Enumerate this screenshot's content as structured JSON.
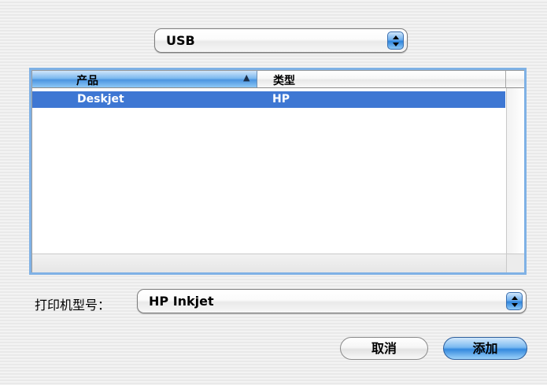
{
  "connection_popup": {
    "value": "USB"
  },
  "list": {
    "columns": [
      "产品",
      "类型"
    ],
    "sort_indicator": "▲",
    "rows": [
      {
        "product": "Deskjet",
        "type": "HP",
        "selected": true
      }
    ]
  },
  "model": {
    "label": "打印机型号：",
    "value": "HP Inkjet"
  },
  "buttons": {
    "cancel": "取消",
    "add": "添加"
  },
  "colors": {
    "selection": "#3e77d3",
    "accent": "#2f84db",
    "focus_ring": "#7fb1e5"
  },
  "icons": [
    "popup-arrows-icon",
    "sort-ascending-icon"
  ]
}
